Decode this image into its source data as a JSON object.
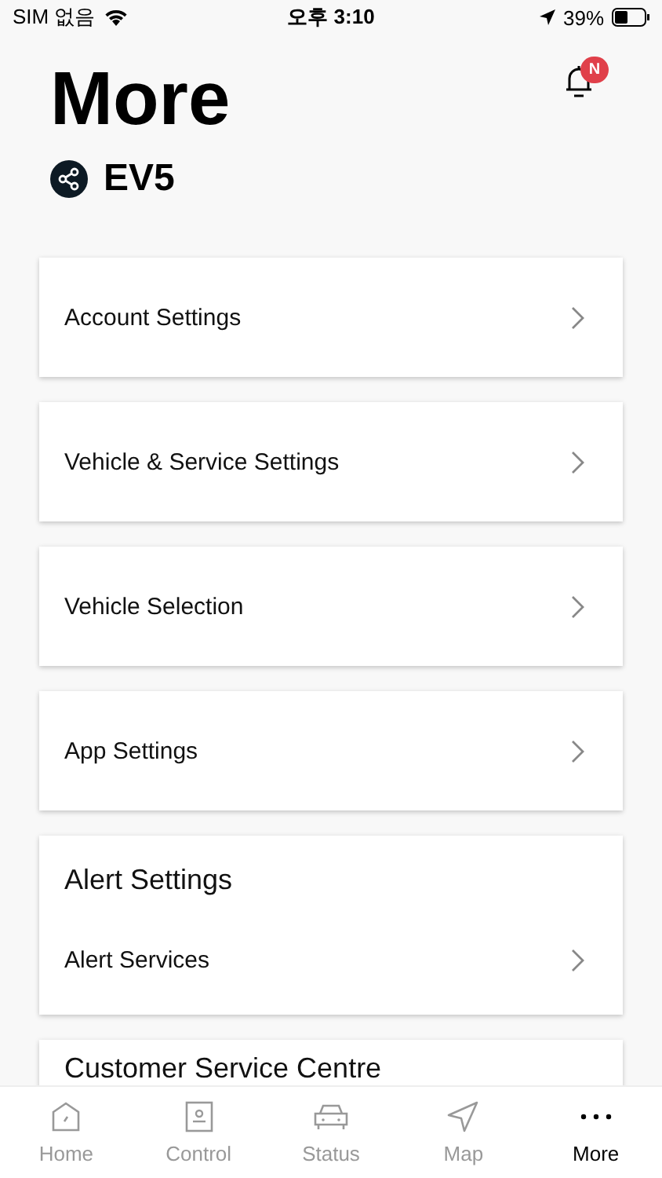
{
  "status_bar": {
    "carrier": "SIM 없음",
    "time": "오후 3:10",
    "battery": "39%"
  },
  "header": {
    "title": "More",
    "vehicle": "EV5",
    "notification_badge": "N"
  },
  "cards": [
    {
      "kind": "link",
      "label": "Account Settings"
    },
    {
      "kind": "link",
      "label": "Vehicle & Service Settings"
    },
    {
      "kind": "link",
      "label": "Vehicle Selection"
    },
    {
      "kind": "link",
      "label": "App Settings"
    },
    {
      "kind": "group",
      "title": "Alert Settings",
      "items": [
        "Alert Services"
      ]
    },
    {
      "kind": "group",
      "title": "Customer Service Centre"
    }
  ],
  "tab_bar": [
    {
      "label": "Home",
      "selected": false
    },
    {
      "label": "Control",
      "selected": false
    },
    {
      "label": "Status",
      "selected": false
    },
    {
      "label": "Map",
      "selected": false
    },
    {
      "label": "More",
      "selected": true
    }
  ]
}
